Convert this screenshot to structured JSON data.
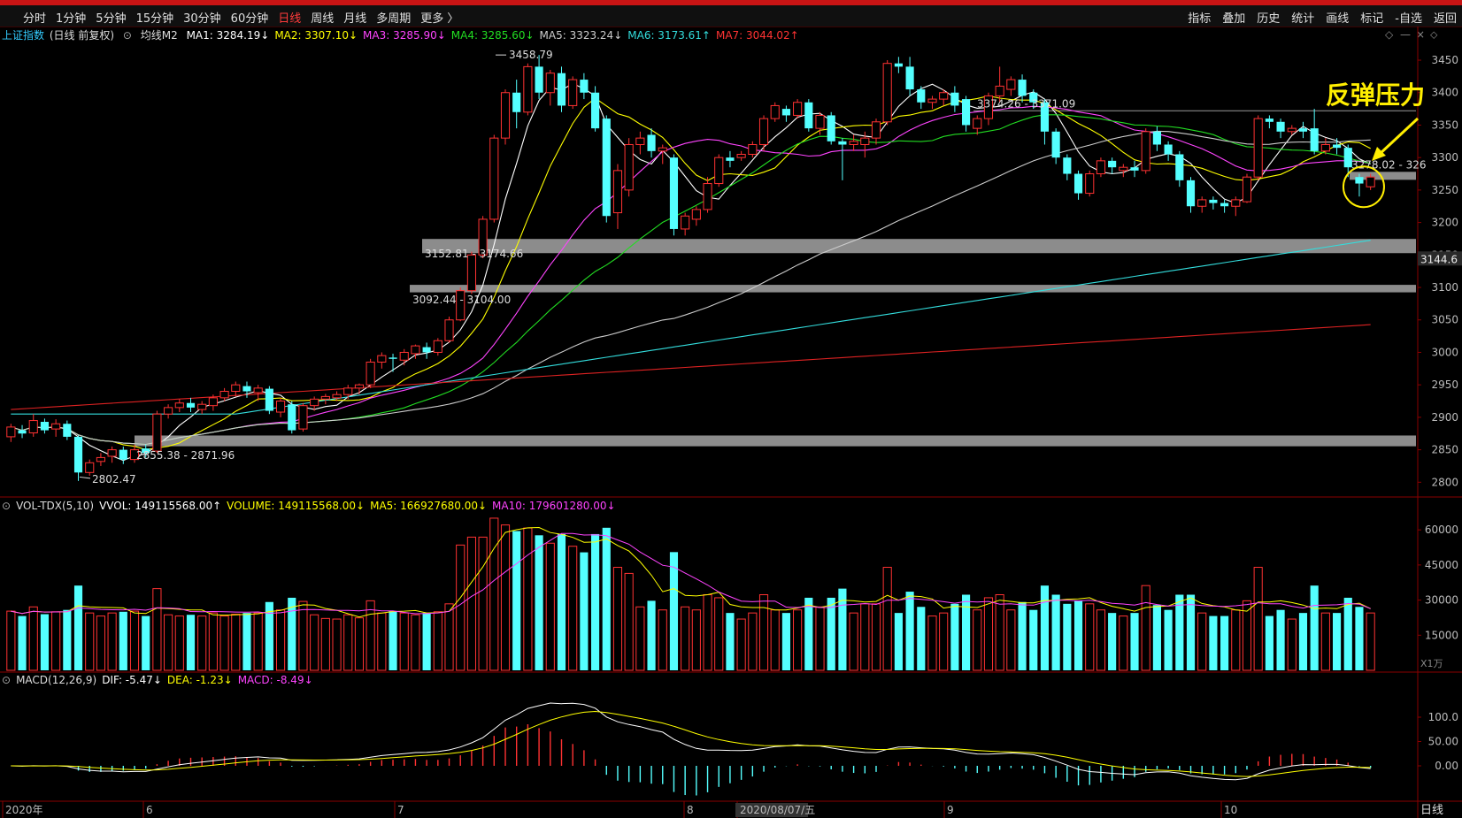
{
  "toolbar": {
    "periods": [
      "分时",
      "1分钟",
      "5分钟",
      "15分钟",
      "30分钟",
      "60分钟",
      "日线",
      "周线",
      "月线",
      "多周期",
      "更多 〉"
    ],
    "active_period": "日线",
    "right": [
      "指标",
      "叠加",
      "历史",
      "统计",
      "画线",
      "标记",
      "-自选",
      "返回"
    ]
  },
  "price_header": {
    "name": "上证指数",
    "mode": "(日线 前复权)",
    "indicator": "均线M2",
    "ma": [
      {
        "label": "MA1: 3284.19↓",
        "color": "#ffffff"
      },
      {
        "label": "MA2: 3307.10↓",
        "color": "#ffff00"
      },
      {
        "label": "MA3: 3285.90↓",
        "color": "#ff44ff"
      },
      {
        "label": "MA4: 3285.60↓",
        "color": "#22dd22"
      },
      {
        "label": "MA5: 3323.24↓",
        "color": "#cccccc"
      },
      {
        "label": "MA6: 3173.61↑",
        "color": "#33dddd"
      },
      {
        "label": "MA7: 3044.02↑",
        "color": "#ff3333"
      }
    ]
  },
  "vol_header": [
    {
      "label": "VOL-TDX(5,10)",
      "color": "#dddddd"
    },
    {
      "label": "VVOL: 149115568.00↑",
      "color": "#ffffff"
    },
    {
      "label": "VOLUME: 149115568.00↓",
      "color": "#ffff00"
    },
    {
      "label": "MA5: 166927680.00↓",
      "color": "#ffff00"
    },
    {
      "label": "MA10: 179601280.00↓",
      "color": "#ff44ff"
    }
  ],
  "macd_header": [
    {
      "label": "MACD(12,26,9)",
      "color": "#dddddd"
    },
    {
      "label": "DIF: -5.47↓",
      "color": "#ffffff"
    },
    {
      "label": "DEA: -1.23↓",
      "color": "#ffff00"
    },
    {
      "label": "MACD: -8.49↓",
      "color": "#ff44ff"
    }
  ],
  "annotation": "反弹压力",
  "price_labels": {
    "high": "3458.79",
    "low": "2802.47",
    "zone1": "3152.81 - 3174.66",
    "zone2": "3092.44 - 3104.00",
    "zone3": "2855.38 - 2871.96",
    "zone4": "3374.26 - 3371.09",
    "zone5": "3278.02 - 326",
    "right_tag": "3144.6"
  },
  "price_axis": [
    "3450",
    "3400",
    "3350",
    "3300",
    "3250",
    "3200",
    "3150",
    "3100",
    "3050",
    "3000",
    "2950",
    "2900",
    "2850",
    "2800"
  ],
  "vol_axis": [
    "60000",
    "45000",
    "30000",
    "15000"
  ],
  "vol_unit": "X1万",
  "macd_axis": [
    "100.0",
    "50.00",
    "0.00"
  ],
  "time_axis": [
    {
      "label": "2020年"
    },
    {
      "label": "6"
    },
    {
      "label": "7"
    },
    {
      "label": "8"
    },
    {
      "label": "2020/08/07/五",
      "highlight": true
    },
    {
      "label": "9"
    },
    {
      "label": "10"
    }
  ],
  "bottom_right": "日线",
  "chart_data": {
    "type": "candlestick",
    "title": "上证指数 (日线 前复权)",
    "ylim": [
      2780,
      3480
    ],
    "candles": [
      [
        2870,
        2885,
        2862,
        2890
      ],
      [
        2880,
        2875,
        2868,
        2888
      ],
      [
        2876,
        2895,
        2870,
        2905
      ],
      [
        2893,
        2880,
        2875,
        2898
      ],
      [
        2882,
        2890,
        2870,
        2897
      ],
      [
        2890,
        2870,
        2865,
        2895
      ],
      [
        2870,
        2815,
        2802,
        2872
      ],
      [
        2815,
        2830,
        2810,
        2835
      ],
      [
        2832,
        2838,
        2825,
        2845
      ],
      [
        2840,
        2850,
        2830,
        2855
      ],
      [
        2850,
        2835,
        2828,
        2855
      ],
      [
        2835,
        2850,
        2830,
        2858
      ],
      [
        2852,
        2845,
        2838,
        2858
      ],
      [
        2848,
        2905,
        2845,
        2910
      ],
      [
        2905,
        2915,
        2898,
        2920
      ],
      [
        2915,
        2922,
        2908,
        2928
      ],
      [
        2922,
        2915,
        2908,
        2930
      ],
      [
        2912,
        2920,
        2905,
        2925
      ],
      [
        2918,
        2930,
        2910,
        2935
      ],
      [
        2930,
        2940,
        2925,
        2945
      ],
      [
        2940,
        2950,
        2932,
        2955
      ],
      [
        2948,
        2940,
        2930,
        2955
      ],
      [
        2938,
        2945,
        2925,
        2950
      ],
      [
        2944,
        2910,
        2905,
        2948
      ],
      [
        2908,
        2925,
        2900,
        2930
      ],
      [
        2920,
        2880,
        2875,
        2925
      ],
      [
        2882,
        2918,
        2878,
        2922
      ],
      [
        2918,
        2928,
        2910,
        2932
      ],
      [
        2928,
        2932,
        2920,
        2936
      ],
      [
        2930,
        2935,
        2925,
        2940
      ],
      [
        2935,
        2945,
        2928,
        2950
      ],
      [
        2945,
        2950,
        2935,
        2952
      ],
      [
        2950,
        2985,
        2945,
        2990
      ],
      [
        2985,
        2995,
        2975,
        3000
      ],
      [
        2992,
        2990,
        2970,
        2998
      ],
      [
        2988,
        3000,
        2980,
        3005
      ],
      [
        2998,
        3010,
        2990,
        3012
      ],
      [
        3008,
        3000,
        2990,
        3015
      ],
      [
        3000,
        3018,
        2995,
        3022
      ],
      [
        3018,
        3050,
        3015,
        3055
      ],
      [
        3050,
        3095,
        3048,
        3100
      ],
      [
        3095,
        3150,
        3090,
        3155
      ],
      [
        3150,
        3205,
        3145,
        3210
      ],
      [
        3205,
        3330,
        3200,
        3335
      ],
      [
        3330,
        3400,
        3320,
        3405
      ],
      [
        3400,
        3370,
        3345,
        3420
      ],
      [
        3370,
        3440,
        3365,
        3445
      ],
      [
        3440,
        3400,
        3390,
        3458
      ],
      [
        3400,
        3430,
        3380,
        3435
      ],
      [
        3430,
        3380,
        3370,
        3440
      ],
      [
        3380,
        3420,
        3375,
        3425
      ],
      [
        3420,
        3400,
        3390,
        3430
      ],
      [
        3400,
        3345,
        3340,
        3410
      ],
      [
        3360,
        3210,
        3200,
        3365
      ],
      [
        3215,
        3280,
        3190,
        3290
      ],
      [
        3250,
        3320,
        3240,
        3330
      ],
      [
        3320,
        3330,
        3305,
        3340
      ],
      [
        3335,
        3310,
        3300,
        3345
      ],
      [
        3310,
        3315,
        3290,
        3320
      ],
      [
        3300,
        3190,
        3180,
        3305
      ],
      [
        3190,
        3210,
        3180,
        3215
      ],
      [
        3205,
        3220,
        3195,
        3225
      ],
      [
        3220,
        3260,
        3215,
        3270
      ],
      [
        3260,
        3300,
        3255,
        3305
      ],
      [
        3300,
        3295,
        3285,
        3310
      ],
      [
        3300,
        3305,
        3295,
        3310
      ],
      [
        3305,
        3320,
        3300,
        3325
      ],
      [
        3320,
        3360,
        3310,
        3365
      ],
      [
        3360,
        3380,
        3355,
        3385
      ],
      [
        3375,
        3365,
        3355,
        3380
      ],
      [
        3365,
        3385,
        3360,
        3390
      ],
      [
        3385,
        3345,
        3340,
        3390
      ],
      [
        3345,
        3365,
        3335,
        3370
      ],
      [
        3365,
        3325,
        3320,
        3370
      ],
      [
        3325,
        3320,
        3265,
        3330
      ],
      [
        3320,
        3325,
        3310,
        3335
      ],
      [
        3320,
        3330,
        3300,
        3340
      ],
      [
        3330,
        3355,
        3320,
        3360
      ],
      [
        3355,
        3445,
        3350,
        3450
      ],
      [
        3445,
        3440,
        3430,
        3455
      ],
      [
        3440,
        3405,
        3395,
        3455
      ],
      [
        3405,
        3385,
        3375,
        3410
      ],
      [
        3385,
        3390,
        3375,
        3395
      ],
      [
        3390,
        3400,
        3380,
        3405
      ],
      [
        3400,
        3380,
        3370,
        3410
      ],
      [
        3390,
        3350,
        3340,
        3395
      ],
      [
        3345,
        3360,
        3335,
        3365
      ],
      [
        3360,
        3395,
        3350,
        3400
      ],
      [
        3395,
        3410,
        3385,
        3440
      ],
      [
        3405,
        3420,
        3395,
        3425
      ],
      [
        3420,
        3395,
        3385,
        3428
      ],
      [
        3400,
        3385,
        3375,
        3405
      ],
      [
        3385,
        3340,
        3320,
        3390
      ],
      [
        3340,
        3300,
        3290,
        3345
      ],
      [
        3300,
        3275,
        3265,
        3305
      ],
      [
        3275,
        3245,
        3235,
        3280
      ],
      [
        3245,
        3275,
        3240,
        3280
      ],
      [
        3275,
        3295,
        3270,
        3300
      ],
      [
        3295,
        3285,
        3275,
        3300
      ],
      [
        3280,
        3285,
        3270,
        3290
      ],
      [
        3285,
        3280,
        3270,
        3295
      ],
      [
        3280,
        3340,
        3275,
        3345
      ],
      [
        3340,
        3320,
        3310,
        3348
      ],
      [
        3320,
        3305,
        3295,
        3325
      ],
      [
        3305,
        3265,
        3255,
        3310
      ],
      [
        3265,
        3225,
        3215,
        3270
      ],
      [
        3225,
        3235,
        3215,
        3240
      ],
      [
        3235,
        3230,
        3220,
        3240
      ],
      [
        3230,
        3225,
        3215,
        3235
      ],
      [
        3225,
        3235,
        3210,
        3240
      ],
      [
        3232,
        3270,
        3230,
        3275
      ],
      [
        3270,
        3360,
        3265,
        3365
      ],
      [
        3360,
        3355,
        3345,
        3365
      ],
      [
        3355,
        3340,
        3330,
        3360
      ],
      [
        3340,
        3345,
        3335,
        3350
      ],
      [
        3345,
        3340,
        3330,
        3355
      ],
      [
        3345,
        3310,
        3305,
        3375
      ],
      [
        3310,
        3320,
        3305,
        3330
      ],
      [
        3320,
        3315,
        3305,
        3330
      ],
      [
        3315,
        3285,
        3270,
        3320
      ],
      [
        3270,
        3260,
        3240,
        3275
      ],
      [
        3255,
        3270,
        3250,
        3275
      ]
    ]
  }
}
